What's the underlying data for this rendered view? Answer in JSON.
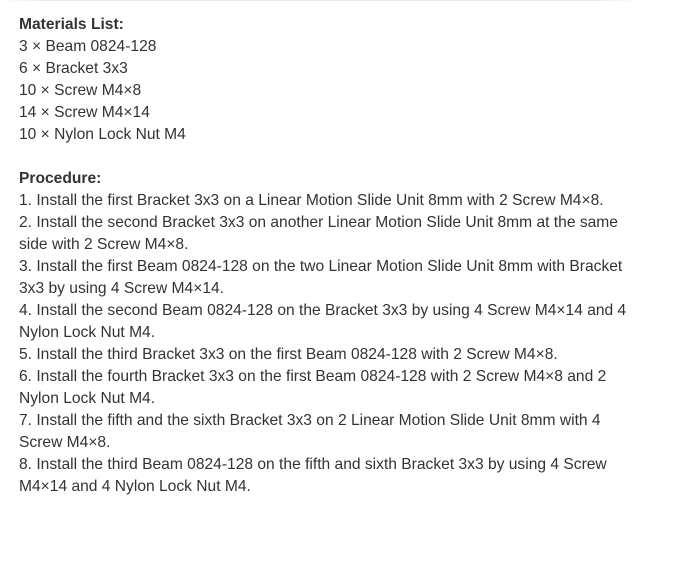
{
  "materials": {
    "heading": "Materials List:",
    "items": [
      "3 × Beam 0824-128",
      "6 × Bracket 3x3",
      "10 × Screw M4×8",
      "14 × Screw M4×14",
      "10 × Nylon Lock Nut M4"
    ]
  },
  "procedure": {
    "heading": "Procedure:",
    "steps": [
      "1. Install the first Bracket 3x3 on a Linear Motion Slide Unit 8mm with 2 Screw M4×8.",
      "2. Install the second  Bracket 3x3 on another Linear Motion Slide Unit 8mm at the same side with 2 Screw M4×8.",
      "3. Install the first Beam 0824-128 on the two Linear Motion Slide Unit 8mm with Bracket 3x3 by using 4 Screw M4×14.",
      "4. Install the second Beam 0824-128 on the  Bracket 3x3 by using 4 Screw M4×14 and 4 Nylon Lock Nut M4.",
      "5. Install the third Bracket 3x3 on the first Beam 0824-128 with 2 Screw M4×8.",
      "6. Install the fourth Bracket 3x3 on the first Beam 0824-128 with 2 Screw M4×8 and 2 Nylon Lock Nut M4.",
      "7. Install the fifth and the sixth Bracket 3x3 on 2 Linear Motion Slide Unit 8mm with 4  Screw M4×8.",
      "8. Install the third Beam 0824-128 on the fifth and sixth  Bracket 3x3 by using 4 Screw M4×14 and 4 Nylon Lock Nut M4."
    ]
  }
}
